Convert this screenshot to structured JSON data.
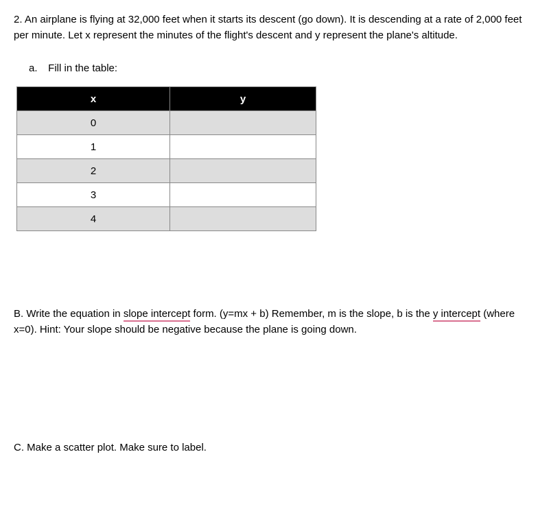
{
  "problem": {
    "text": "2.  An airplane is flying at 32,000 feet when it starts its descent (go down).  It is descending at a rate of 2,000 feet per minute.  Let x represent the minutes of the flight's descent and y represent the plane's altitude."
  },
  "partA": {
    "label": "a.",
    "text": "Fill in the table:"
  },
  "table": {
    "headers": {
      "x": "x",
      "y": "y"
    },
    "rows": [
      {
        "x": "0",
        "y": ""
      },
      {
        "x": "1",
        "y": ""
      },
      {
        "x": "2",
        "y": ""
      },
      {
        "x": "3",
        "y": ""
      },
      {
        "x": "4",
        "y": ""
      }
    ]
  },
  "partB": {
    "prefix": "B.  Write the equation in ",
    "underlined1": "slope intercept",
    "mid1": " form. (y=mx + b)  Remember, m is the slope, b is the ",
    "underlined2": "y intercept",
    "suffix": " (where x=0).  Hint:  Your slope should be negative because the plane is going down."
  },
  "partC": {
    "text": "C.  Make a scatter plot.  Make sure to label."
  }
}
